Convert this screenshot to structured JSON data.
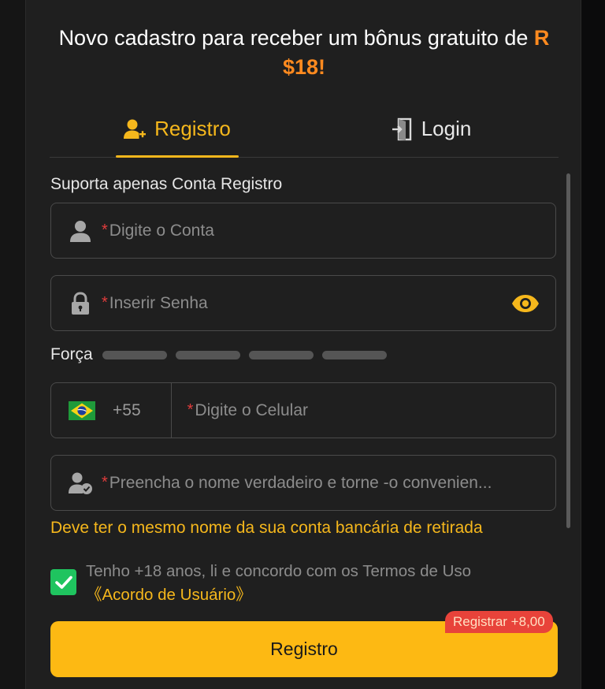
{
  "promo": {
    "text": "Novo cadastro para receber um bônus gratuito de ",
    "amount": "R $18!"
  },
  "tabs": [
    {
      "label": "Registro",
      "icon": "user-plus-icon",
      "active": true
    },
    {
      "label": "Login",
      "icon": "login-door-icon",
      "active": false
    }
  ],
  "form": {
    "section_label": "Suporta apenas Conta Registro",
    "required_mark": "*",
    "account": {
      "placeholder": "Digite o Conta",
      "value": ""
    },
    "password": {
      "placeholder": "Inserir Senha",
      "value": ""
    },
    "strength": {
      "label": "Força",
      "level": 0,
      "segments": 4
    },
    "phone": {
      "country": "Brasil",
      "dial_code": "+55",
      "placeholder": "Digite o Celular",
      "value": ""
    },
    "name": {
      "placeholder": "Preencha o nome verdadeiro e torne -o convenien...",
      "value": ""
    },
    "name_hint": "Deve ter o mesmo nome da sua conta bancária de retirada",
    "agree": {
      "checked": true,
      "text": "Tenho +18 anos, li e concordo com os Termos de Uso",
      "link": "《Acordo de Usuário》"
    },
    "submit_label": "Registro",
    "bonus_badge": "Registrar +8,00"
  },
  "colors": {
    "accent": "#f5b71c",
    "button": "#fdb913",
    "promo_amount": "#ff8a1f",
    "checkbox": "#1fc45f",
    "badge": "#e8433a"
  }
}
